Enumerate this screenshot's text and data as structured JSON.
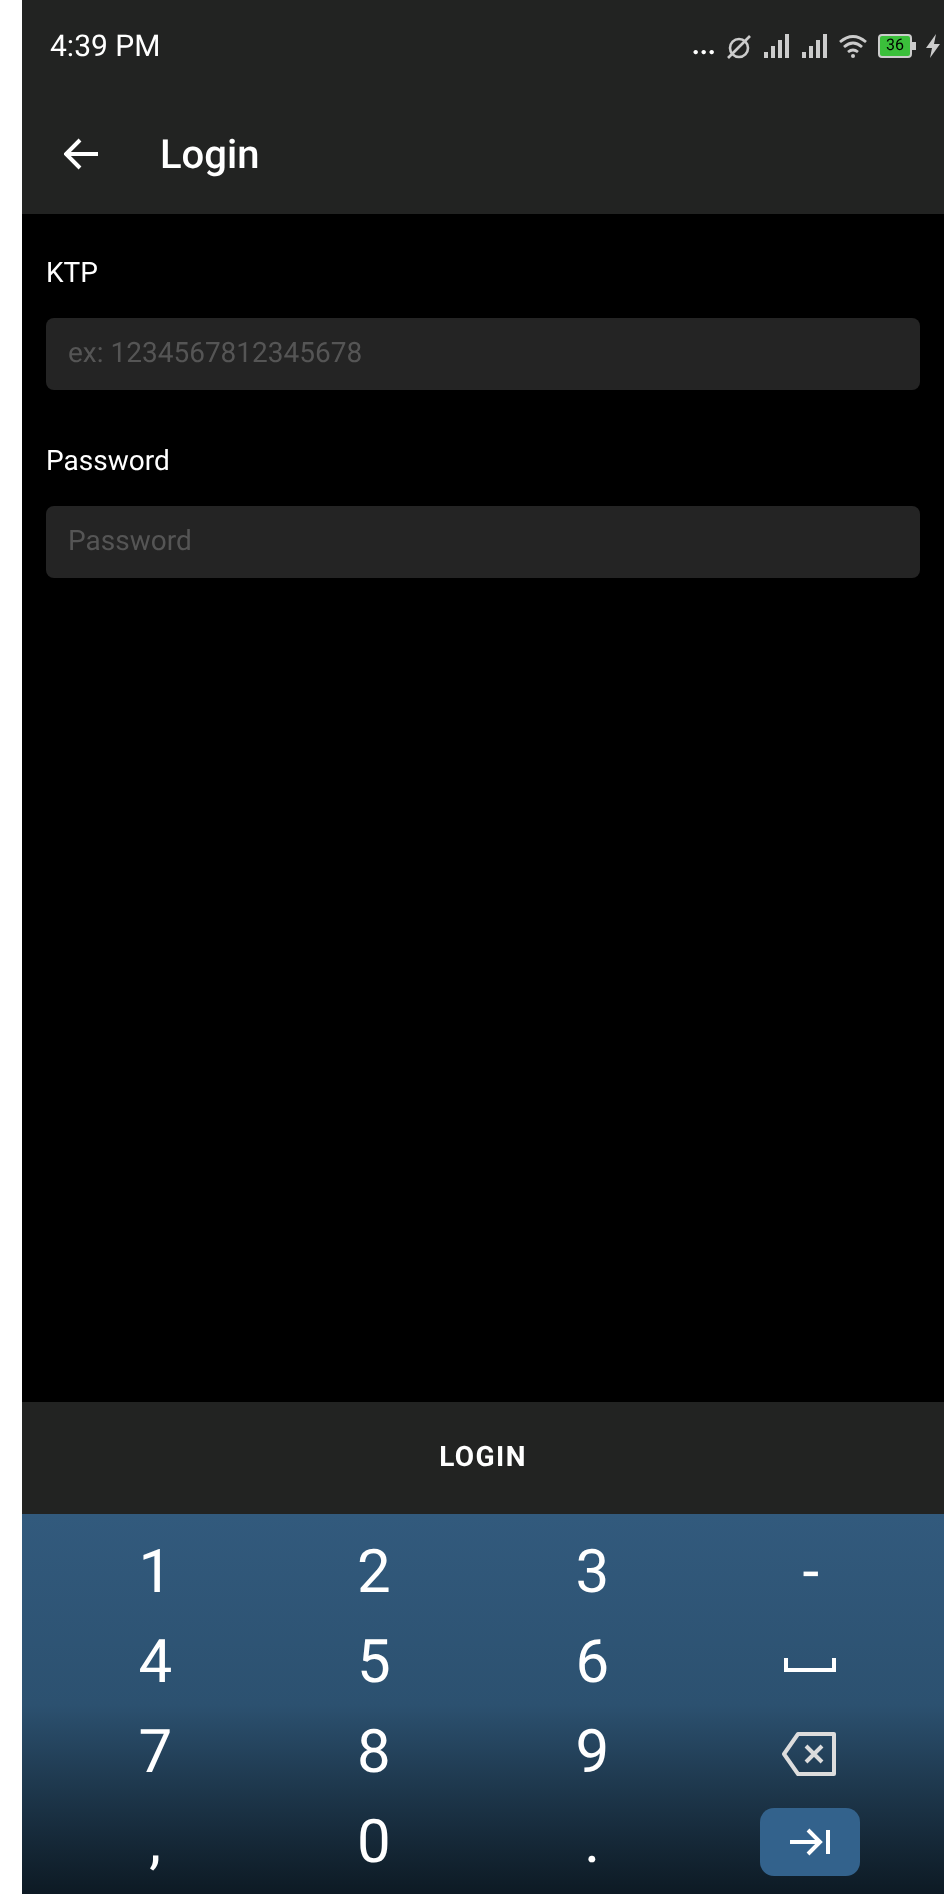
{
  "status_bar": {
    "time": "4:39 PM",
    "more": "...",
    "battery": "36"
  },
  "app_bar": {
    "title": "Login"
  },
  "fields": [
    {
      "label": "KTP",
      "placeholder": "ex: 1234567812345678"
    },
    {
      "label": "Password",
      "placeholder": "Password"
    }
  ],
  "login_button": "LOGIN",
  "keyboard": [
    [
      {
        "kind": "char",
        "label": "1"
      },
      {
        "kind": "char",
        "label": "2"
      },
      {
        "kind": "char",
        "label": "3"
      },
      {
        "kind": "char",
        "label": "-"
      }
    ],
    [
      {
        "kind": "char",
        "label": "4"
      },
      {
        "kind": "char",
        "label": "5"
      },
      {
        "kind": "char",
        "label": "6"
      },
      {
        "kind": "space"
      }
    ],
    [
      {
        "kind": "char",
        "label": "7"
      },
      {
        "kind": "char",
        "label": "8"
      },
      {
        "kind": "char",
        "label": "9"
      },
      {
        "kind": "backspace"
      }
    ],
    [
      {
        "kind": "char",
        "label": ","
      },
      {
        "kind": "char",
        "label": "0"
      },
      {
        "kind": "char",
        "label": "."
      },
      {
        "kind": "tab"
      }
    ]
  ]
}
